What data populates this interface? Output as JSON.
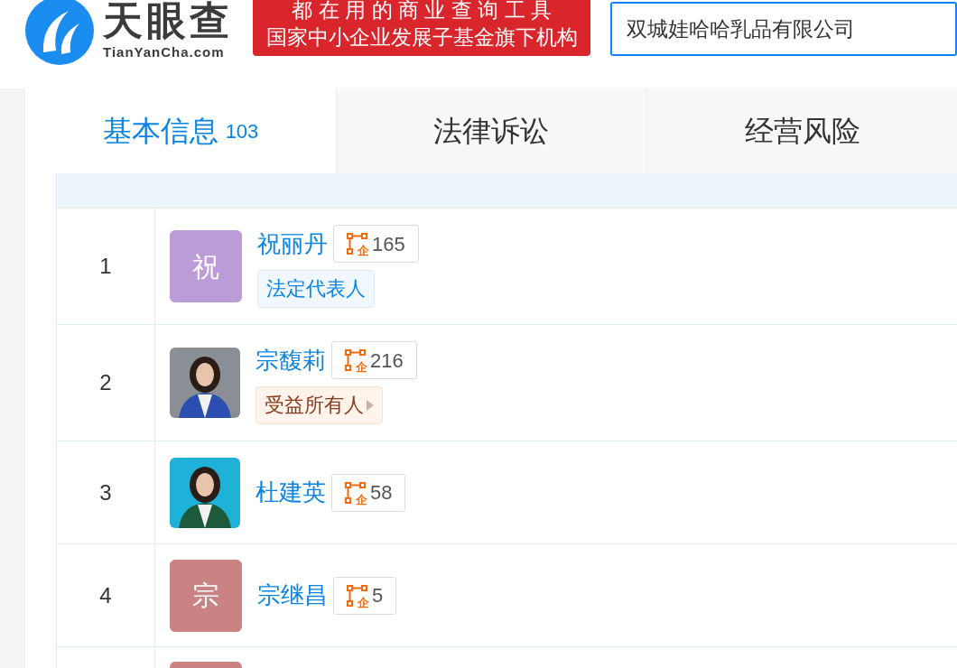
{
  "logo": {
    "title": "天眼查",
    "domain": "TianYanCha.com"
  },
  "banner": {
    "line_1": "都 在 用 的 商 业 查 询 工 具",
    "line_2": "国家中小企业发展子基金旗下机构"
  },
  "search": {
    "value": "双城娃哈哈乳品有限公司"
  },
  "tabs": [
    {
      "label": "基本信息",
      "count": "103",
      "selected": true
    },
    {
      "label": "法律诉讼",
      "selected": false
    },
    {
      "label": "经营风险",
      "selected": false
    }
  ],
  "table": {
    "rows": [
      {
        "index": "1",
        "avatar": {
          "kind": "letter",
          "text": "祝",
          "color": "#bb9cd8"
        },
        "name": "祝丽丹",
        "icon_text": "企",
        "count": "165",
        "tag": {
          "kind": "legal",
          "text": "法定代表人"
        }
      },
      {
        "index": "2",
        "name": "宗馥莉",
        "icon_text": "企",
        "count": "216",
        "tag": {
          "kind": "beneficiary",
          "text": "受益所有人"
        }
      },
      {
        "index": "3",
        "name": "杜建英",
        "icon_text": "企",
        "count": "58"
      },
      {
        "index": "4",
        "avatar": {
          "kind": "letter",
          "text": "宗",
          "color": "#c98383"
        },
        "name": "宗继昌",
        "icon_text": "企",
        "count": "5"
      },
      {
        "avatar": {
          "kind": "blank",
          "color": "#c98383"
        }
      }
    ]
  }
}
